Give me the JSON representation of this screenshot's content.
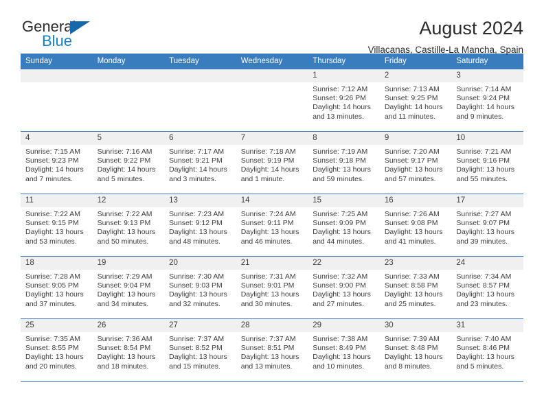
{
  "brand": {
    "name_top": "General",
    "name_bottom": "Blue",
    "accent_color": "#1a7fc1",
    "triangle_color": "#1667ab"
  },
  "header": {
    "title": "August 2024",
    "subtitle": "Villacanas, Castille-La Mancha, Spain"
  },
  "calendar": {
    "header_bg": "#3a7dbf",
    "daynum_bg": "#f0f0f0",
    "weekday_headers": [
      "Sunday",
      "Monday",
      "Tuesday",
      "Wednesday",
      "Thursday",
      "Friday",
      "Saturday"
    ],
    "weeks": [
      [
        {
          "day": "",
          "sunrise": "",
          "sunset": "",
          "daylight": "",
          "empty": true
        },
        {
          "day": "",
          "sunrise": "",
          "sunset": "",
          "daylight": "",
          "empty": true
        },
        {
          "day": "",
          "sunrise": "",
          "sunset": "",
          "daylight": "",
          "empty": true
        },
        {
          "day": "",
          "sunrise": "",
          "sunset": "",
          "daylight": "",
          "empty": true
        },
        {
          "day": "1",
          "sunrise": "Sunrise: 7:12 AM",
          "sunset": "Sunset: 9:26 PM",
          "daylight": "Daylight: 14 hours and 13 minutes."
        },
        {
          "day": "2",
          "sunrise": "Sunrise: 7:13 AM",
          "sunset": "Sunset: 9:25 PM",
          "daylight": "Daylight: 14 hours and 11 minutes."
        },
        {
          "day": "3",
          "sunrise": "Sunrise: 7:14 AM",
          "sunset": "Sunset: 9:24 PM",
          "daylight": "Daylight: 14 hours and 9 minutes."
        }
      ],
      [
        {
          "day": "4",
          "sunrise": "Sunrise: 7:15 AM",
          "sunset": "Sunset: 9:23 PM",
          "daylight": "Daylight: 14 hours and 7 minutes."
        },
        {
          "day": "5",
          "sunrise": "Sunrise: 7:16 AM",
          "sunset": "Sunset: 9:22 PM",
          "daylight": "Daylight: 14 hours and 5 minutes."
        },
        {
          "day": "6",
          "sunrise": "Sunrise: 7:17 AM",
          "sunset": "Sunset: 9:21 PM",
          "daylight": "Daylight: 14 hours and 3 minutes."
        },
        {
          "day": "7",
          "sunrise": "Sunrise: 7:18 AM",
          "sunset": "Sunset: 9:19 PM",
          "daylight": "Daylight: 14 hours and 1 minute."
        },
        {
          "day": "8",
          "sunrise": "Sunrise: 7:19 AM",
          "sunset": "Sunset: 9:18 PM",
          "daylight": "Daylight: 13 hours and 59 minutes."
        },
        {
          "day": "9",
          "sunrise": "Sunrise: 7:20 AM",
          "sunset": "Sunset: 9:17 PM",
          "daylight": "Daylight: 13 hours and 57 minutes."
        },
        {
          "day": "10",
          "sunrise": "Sunrise: 7:21 AM",
          "sunset": "Sunset: 9:16 PM",
          "daylight": "Daylight: 13 hours and 55 minutes."
        }
      ],
      [
        {
          "day": "11",
          "sunrise": "Sunrise: 7:22 AM",
          "sunset": "Sunset: 9:15 PM",
          "daylight": "Daylight: 13 hours and 53 minutes."
        },
        {
          "day": "12",
          "sunrise": "Sunrise: 7:22 AM",
          "sunset": "Sunset: 9:13 PM",
          "daylight": "Daylight: 13 hours and 50 minutes."
        },
        {
          "day": "13",
          "sunrise": "Sunrise: 7:23 AM",
          "sunset": "Sunset: 9:12 PM",
          "daylight": "Daylight: 13 hours and 48 minutes."
        },
        {
          "day": "14",
          "sunrise": "Sunrise: 7:24 AM",
          "sunset": "Sunset: 9:11 PM",
          "daylight": "Daylight: 13 hours and 46 minutes."
        },
        {
          "day": "15",
          "sunrise": "Sunrise: 7:25 AM",
          "sunset": "Sunset: 9:09 PM",
          "daylight": "Daylight: 13 hours and 44 minutes."
        },
        {
          "day": "16",
          "sunrise": "Sunrise: 7:26 AM",
          "sunset": "Sunset: 9:08 PM",
          "daylight": "Daylight: 13 hours and 41 minutes."
        },
        {
          "day": "17",
          "sunrise": "Sunrise: 7:27 AM",
          "sunset": "Sunset: 9:07 PM",
          "daylight": "Daylight: 13 hours and 39 minutes."
        }
      ],
      [
        {
          "day": "18",
          "sunrise": "Sunrise: 7:28 AM",
          "sunset": "Sunset: 9:05 PM",
          "daylight": "Daylight: 13 hours and 37 minutes."
        },
        {
          "day": "19",
          "sunrise": "Sunrise: 7:29 AM",
          "sunset": "Sunset: 9:04 PM",
          "daylight": "Daylight: 13 hours and 34 minutes."
        },
        {
          "day": "20",
          "sunrise": "Sunrise: 7:30 AM",
          "sunset": "Sunset: 9:03 PM",
          "daylight": "Daylight: 13 hours and 32 minutes."
        },
        {
          "day": "21",
          "sunrise": "Sunrise: 7:31 AM",
          "sunset": "Sunset: 9:01 PM",
          "daylight": "Daylight: 13 hours and 30 minutes."
        },
        {
          "day": "22",
          "sunrise": "Sunrise: 7:32 AM",
          "sunset": "Sunset: 9:00 PM",
          "daylight": "Daylight: 13 hours and 27 minutes."
        },
        {
          "day": "23",
          "sunrise": "Sunrise: 7:33 AM",
          "sunset": "Sunset: 8:58 PM",
          "daylight": "Daylight: 13 hours and 25 minutes."
        },
        {
          "day": "24",
          "sunrise": "Sunrise: 7:34 AM",
          "sunset": "Sunset: 8:57 PM",
          "daylight": "Daylight: 13 hours and 23 minutes."
        }
      ],
      [
        {
          "day": "25",
          "sunrise": "Sunrise: 7:35 AM",
          "sunset": "Sunset: 8:55 PM",
          "daylight": "Daylight: 13 hours and 20 minutes."
        },
        {
          "day": "26",
          "sunrise": "Sunrise: 7:36 AM",
          "sunset": "Sunset: 8:54 PM",
          "daylight": "Daylight: 13 hours and 18 minutes."
        },
        {
          "day": "27",
          "sunrise": "Sunrise: 7:37 AM",
          "sunset": "Sunset: 8:52 PM",
          "daylight": "Daylight: 13 hours and 15 minutes."
        },
        {
          "day": "28",
          "sunrise": "Sunrise: 7:37 AM",
          "sunset": "Sunset: 8:51 PM",
          "daylight": "Daylight: 13 hours and 13 minutes."
        },
        {
          "day": "29",
          "sunrise": "Sunrise: 7:38 AM",
          "sunset": "Sunset: 8:49 PM",
          "daylight": "Daylight: 13 hours and 10 minutes."
        },
        {
          "day": "30",
          "sunrise": "Sunrise: 7:39 AM",
          "sunset": "Sunset: 8:48 PM",
          "daylight": "Daylight: 13 hours and 8 minutes."
        },
        {
          "day": "31",
          "sunrise": "Sunrise: 7:40 AM",
          "sunset": "Sunset: 8:46 PM",
          "daylight": "Daylight: 13 hours and 5 minutes."
        }
      ]
    ]
  }
}
